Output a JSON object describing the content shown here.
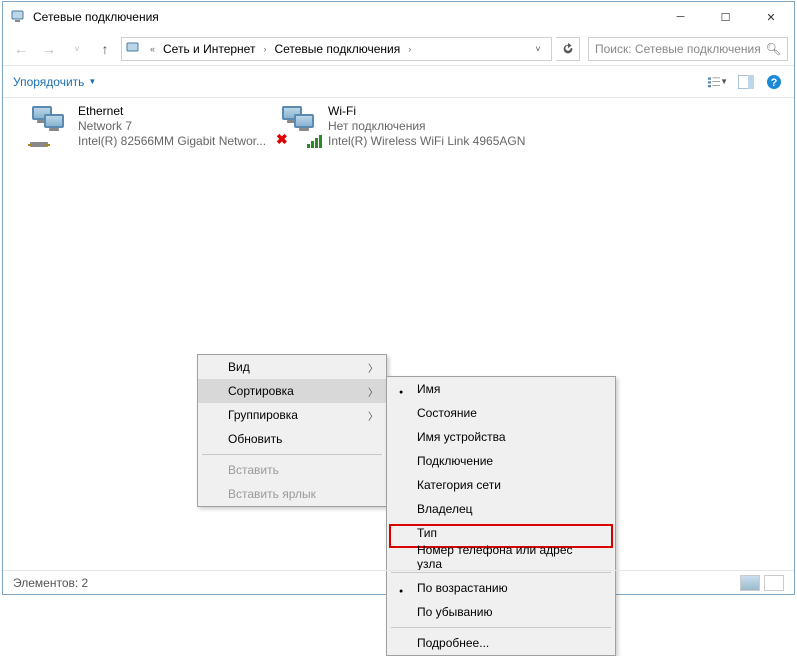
{
  "title": "Сетевые подключения",
  "breadcrumb": {
    "root_sep": "«",
    "l1": "Сеть и Интернет",
    "l2": "Сетевые подключения"
  },
  "search": {
    "placeholder": "Поиск: Сетевые подключения"
  },
  "toolbar": {
    "organize": "Упорядочить"
  },
  "adapters": {
    "ethernet": {
      "name": "Ethernet",
      "status": "Network  7",
      "device": "Intel(R) 82566MM Gigabit Networ..."
    },
    "wifi": {
      "name": "Wi-Fi",
      "status": "Нет подключения",
      "device": "Intel(R) Wireless WiFi Link 4965AGN"
    }
  },
  "context_main": {
    "view": "Вид",
    "sort": "Сортировка",
    "group": "Группировка",
    "refresh": "Обновить",
    "paste": "Вставить",
    "paste_shortcut": "Вставить ярлык"
  },
  "context_sub": {
    "name": "Имя",
    "state": "Состояние",
    "devname": "Имя устройства",
    "connection": "Подключение",
    "netcat": "Категория сети",
    "owner": "Владелец",
    "type": "Тип",
    "phone": "Номер телефона или адрес узла",
    "asc": "По возрастанию",
    "desc": "По убыванию",
    "more": "Подробнее..."
  },
  "status": {
    "elements": "Элементов: 2"
  }
}
